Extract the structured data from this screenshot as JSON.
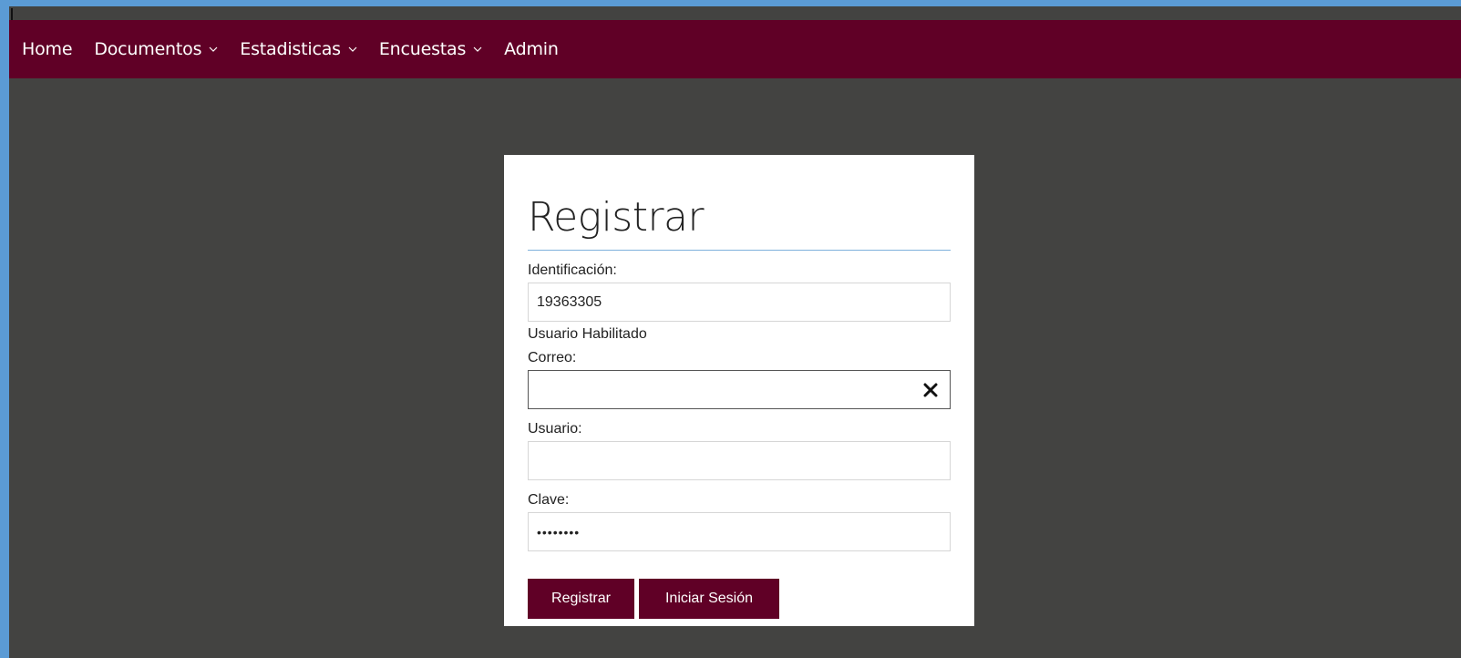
{
  "nav": {
    "items": [
      {
        "label": "Home",
        "has_dropdown": false
      },
      {
        "label": "Documentos",
        "has_dropdown": true
      },
      {
        "label": "Estadisticas",
        "has_dropdown": true
      },
      {
        "label": "Encuestas",
        "has_dropdown": true
      },
      {
        "label": "Admin",
        "has_dropdown": false
      }
    ]
  },
  "form": {
    "title": "Registrar",
    "identificacion": {
      "label": "Identificación:",
      "value": "19363305"
    },
    "status": "Usuario Habilitado",
    "correo": {
      "label": "Correo:",
      "value": ""
    },
    "usuario": {
      "label": "Usuario:",
      "value": ""
    },
    "clave": {
      "label": "Clave:",
      "value": "••••••••"
    },
    "register_label": "Registrar",
    "login_label": "Iniciar Sesión"
  },
  "colors": {
    "brand": "#600026",
    "background": "#434341",
    "outer": "#5b9bd5",
    "accent_rule": "#7fb1dc"
  },
  "icons": {
    "dropdown": "chevron-down-icon",
    "clear": "close-icon"
  }
}
